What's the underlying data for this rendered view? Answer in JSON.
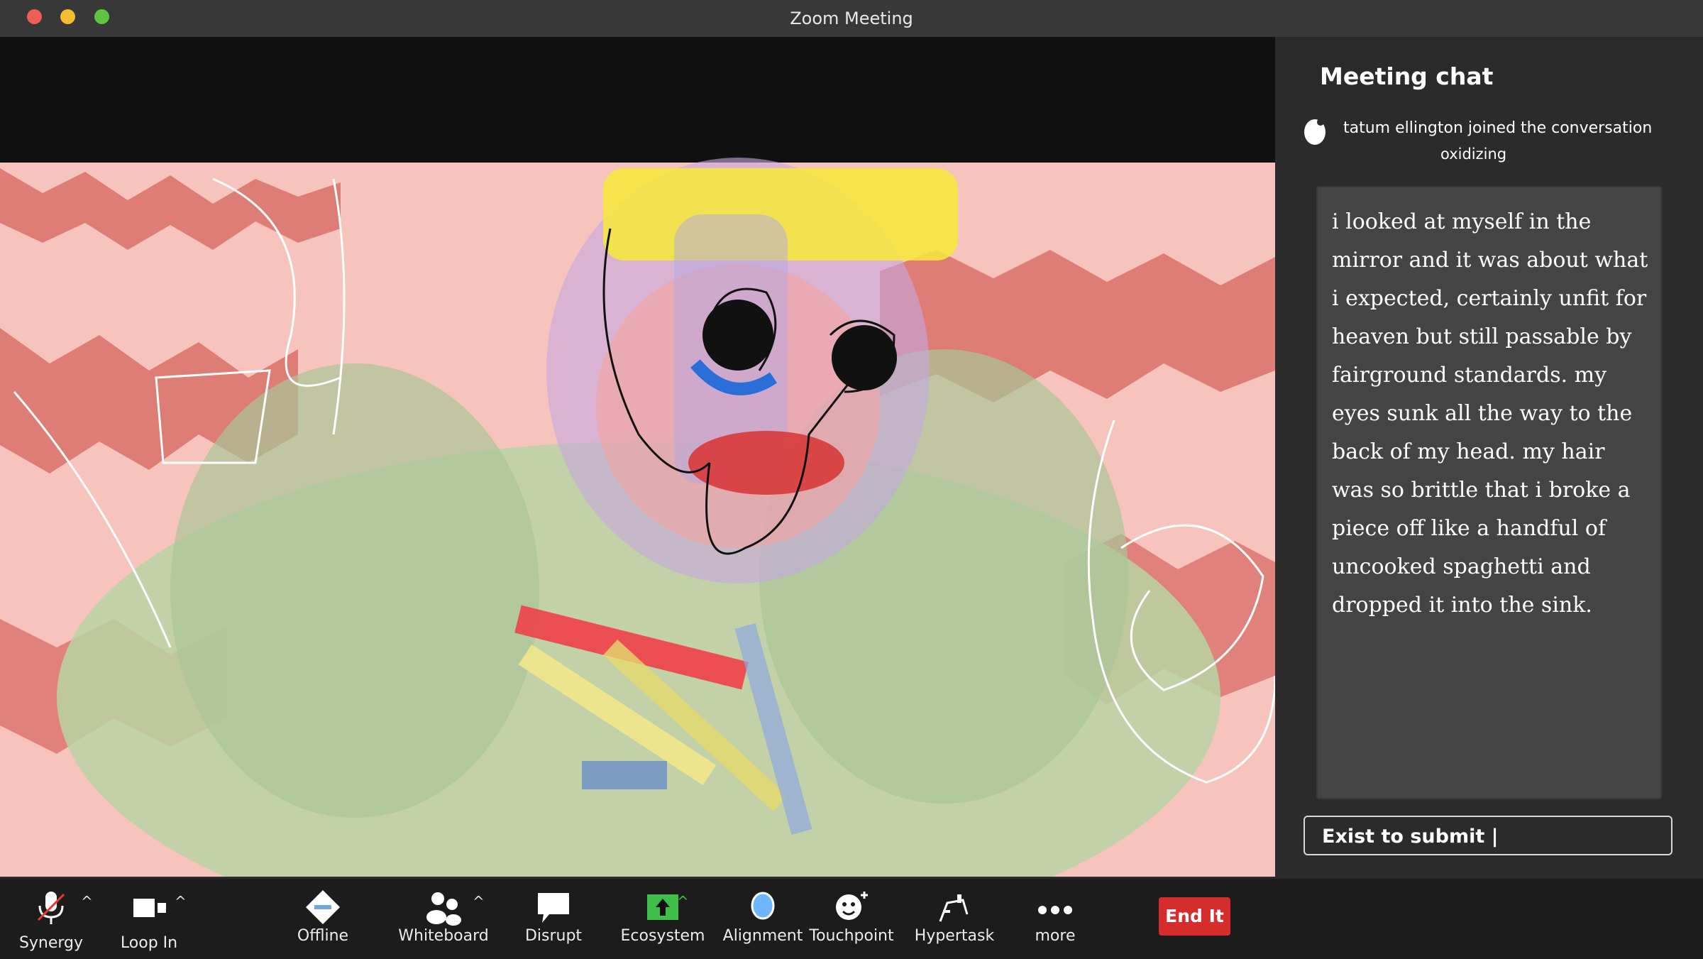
{
  "window": {
    "title": "Zoom Meeting"
  },
  "chat": {
    "title": "Meeting chat",
    "join_line": "tatum ellington  joined the conversation",
    "join_sub": "oxidizing",
    "message": "i looked at myself in the mirror and it was about what i expected, certainly unfit for heaven but still passable by fairground standards. my eyes sunk all the way to the back of my head. my hair was so brittle that i broke a piece off like a handful of uncooked spaghetti and dropped it into the sink.",
    "input_value": "Exist to submit |"
  },
  "toolbar": {
    "synergy": "Synergy",
    "loop_in": "Loop In",
    "offline": "Offline",
    "whiteboard": "Whiteboard",
    "disrupt": "Disrupt",
    "ecosystem": "Ecosystem",
    "alignment": "Alignment",
    "touchpoint": "Touchpoint",
    "hypertask": "Hypertask",
    "more": "more",
    "end": "End It"
  },
  "colors": {
    "end_button": "#d72c2c",
    "ecosystem_icon": "#3fbf4a",
    "alignment_icon": "#6fb6ff"
  },
  "icons": [
    "microphone-muted-icon",
    "video-camera-icon",
    "diamond-icon",
    "participants-icon",
    "speech-bubble-icon",
    "share-arrow-icon",
    "oval-icon",
    "smiley-plus-icon",
    "hypertask-icon",
    "more-dots-icon"
  ]
}
